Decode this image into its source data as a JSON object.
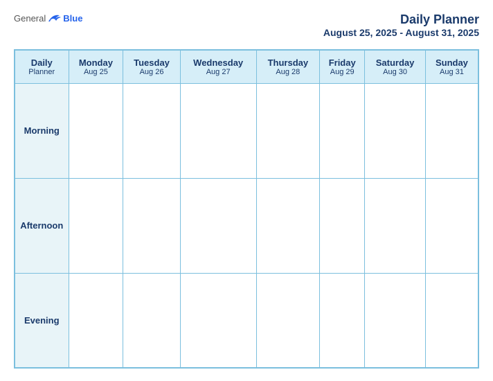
{
  "header": {
    "logo_general": "General",
    "logo_blue": "Blue",
    "title_main": "Daily Planner",
    "title_sub": "August 25, 2025 - August 31, 2025"
  },
  "table": {
    "header_col": {
      "label": "Daily",
      "label2": "Planner"
    },
    "columns": [
      {
        "day": "Monday",
        "date": "Aug 25"
      },
      {
        "day": "Tuesday",
        "date": "Aug 26"
      },
      {
        "day": "Wednesday",
        "date": "Aug 27"
      },
      {
        "day": "Thursday",
        "date": "Aug 28"
      },
      {
        "day": "Friday",
        "date": "Aug 29"
      },
      {
        "day": "Saturday",
        "date": "Aug 30"
      },
      {
        "day": "Sunday",
        "date": "Aug 31"
      }
    ],
    "rows": [
      {
        "label": "Morning"
      },
      {
        "label": "Afternoon"
      },
      {
        "label": "Evening"
      }
    ]
  }
}
